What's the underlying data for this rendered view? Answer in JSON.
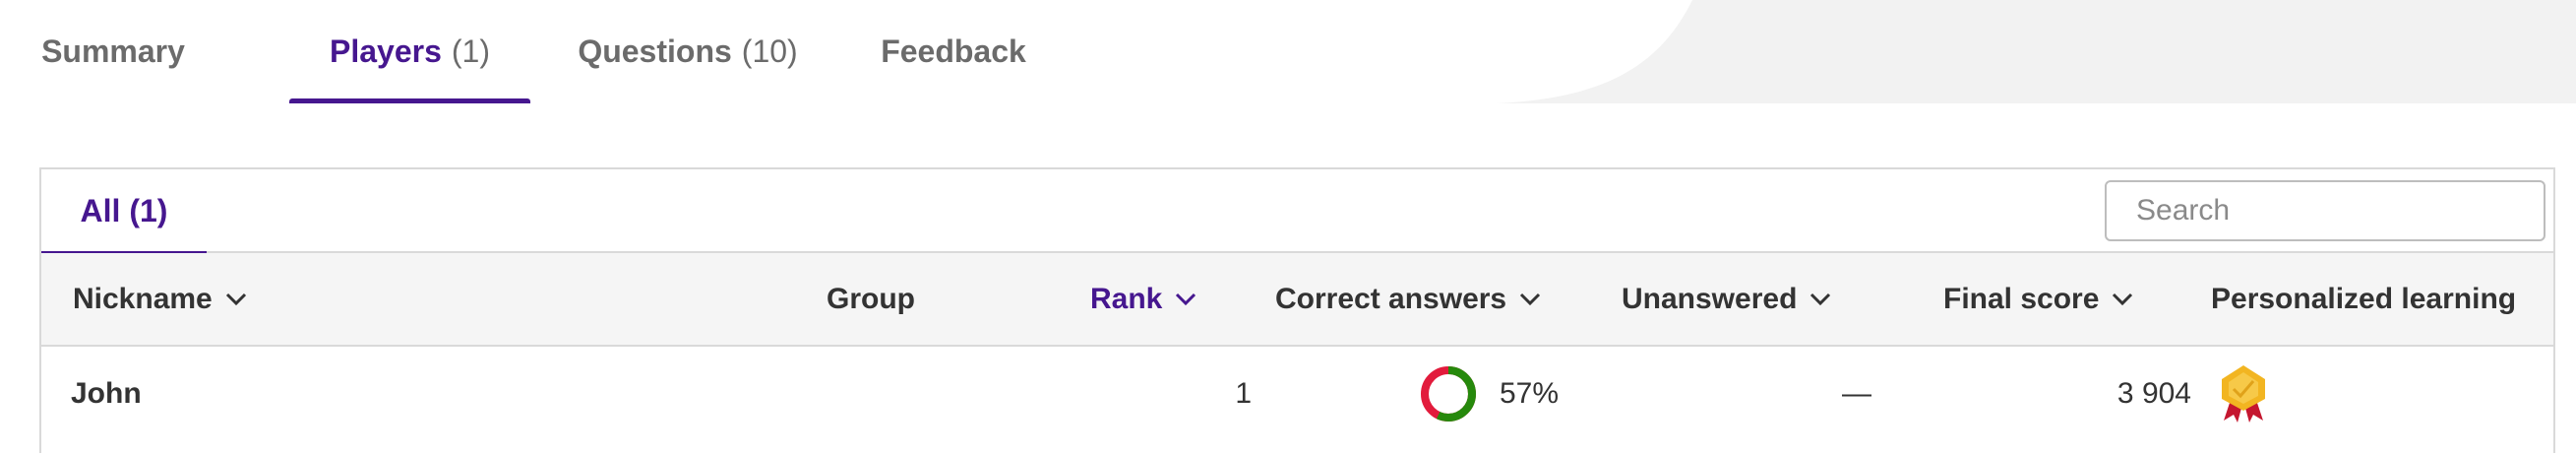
{
  "tabs": [
    {
      "label": "Summary",
      "count": ""
    },
    {
      "label": "Players",
      "count": "(1)"
    },
    {
      "label": "Questions",
      "count": "(10)"
    },
    {
      "label": "Feedback",
      "count": ""
    }
  ],
  "active_tab": "Players",
  "subtab": {
    "label": "All (1)"
  },
  "search": {
    "placeholder": "Search",
    "value": ""
  },
  "columns": {
    "nickname": "Nickname",
    "group": "Group",
    "rank": "Rank",
    "correct": "Correct answers",
    "unanswered": "Unanswered",
    "final_score": "Final score",
    "personalized": "Personalized learning"
  },
  "rows": [
    {
      "nickname": "John",
      "group": "",
      "rank": "1",
      "correct_pct": "57%",
      "correct_fraction": 0.57,
      "unanswered": "—",
      "final_score": "3 904",
      "badge_icon": "medal-icon"
    }
  ],
  "colors": {
    "accent": "#46178f",
    "correct": "#26890c",
    "incorrect": "#e21b3c",
    "medal": "#f2b521",
    "ribbon": "#c5162f"
  }
}
